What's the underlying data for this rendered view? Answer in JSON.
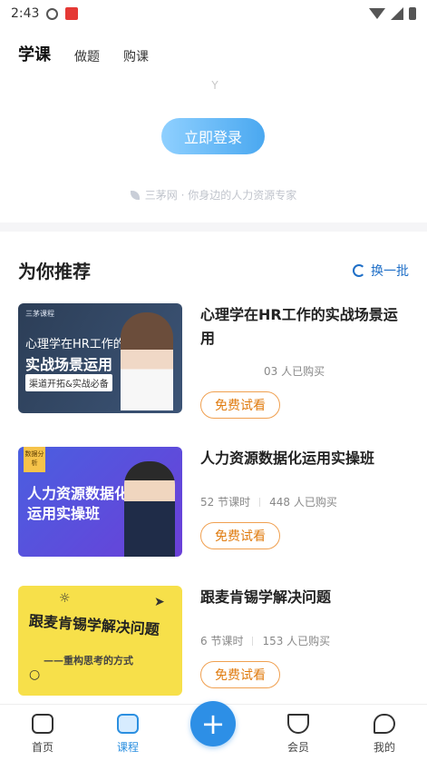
{
  "status_bar": {
    "time": "2:43"
  },
  "header": {
    "tabs": [
      {
        "label": "学课",
        "active": true
      },
      {
        "label": "做题",
        "active": false
      },
      {
        "label": "购课",
        "active": false
      }
    ],
    "login_button": "立即登录",
    "slogan": "三茅网 · 你身边的人力资源专家"
  },
  "recommend": {
    "title": "为你推荐",
    "refresh_label": "换一批",
    "courses": [
      {
        "title": "心理学在HR工作的实战场景运用",
        "lessons": "",
        "buyers": "03 人已购买",
        "button": "免费试看",
        "thumb": {
          "tag": "三茅课程",
          "line1": "心理学在HR工作的",
          "line2": "实战场景运用",
          "line3": "渠道开拓&实战必备"
        }
      },
      {
        "title": "人力资源数据化运用实操班",
        "lessons": "52 节课时",
        "buyers": "448 人已购买",
        "button": "免费试看",
        "thumb": {
          "badge": "数据分析",
          "line1": "人力资源数据化",
          "line2": "运用实操班"
        }
      },
      {
        "title": "跟麦肯锡学解决问题",
        "lessons": "6 节课时",
        "buyers": "153 人已购买",
        "button": "免费试看",
        "thumb": {
          "line1": "跟麦肯锡学解决问题",
          "line2": "——重构思考的方式"
        }
      }
    ]
  },
  "tabbar": {
    "items": [
      {
        "label": "首页",
        "active": false
      },
      {
        "label": "课程",
        "active": true
      },
      {
        "label": "会员",
        "active": false
      },
      {
        "label": "我的",
        "active": false
      }
    ],
    "plus_symbol": "+"
  },
  "colors": {
    "accent": "#2d8fe6",
    "free_button": "#e07c10"
  }
}
